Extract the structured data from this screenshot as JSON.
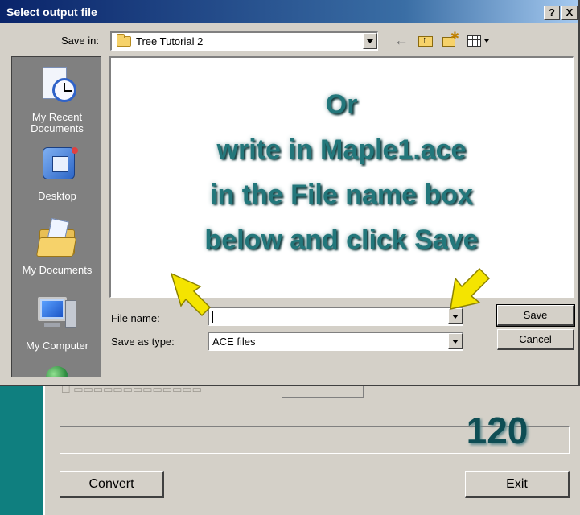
{
  "dialog": {
    "title": "Select output file",
    "help_label": "?",
    "close_label": "X",
    "save_in_label": "Save in:",
    "save_in_value": "Tree Tutorial 2",
    "places": [
      {
        "label_lines": [
          "My Recent",
          "Documents"
        ],
        "icon": "recent-documents-icon"
      },
      {
        "label_lines": [
          "Desktop"
        ],
        "icon": "desktop-icon"
      },
      {
        "label_lines": [
          "My Documents"
        ],
        "icon": "my-documents-icon"
      },
      {
        "label_lines": [
          "My Computer"
        ],
        "icon": "my-computer-icon"
      },
      {
        "label_lines": [],
        "icon": "my-network-icon"
      }
    ],
    "instructions": [
      "Or",
      "write in Maple1.ace",
      "in the File name box",
      "below and click Save"
    ],
    "file_name_label": "File name:",
    "file_name_value": "",
    "save_as_type_label": "Save as type:",
    "save_as_type_value": "ACE files",
    "save_button": "Save",
    "cancel_button": "Cancel"
  },
  "background_app": {
    "progress_value": "120",
    "convert_button": "Convert",
    "exit_button": "Exit"
  },
  "colors": {
    "title_bar": "#0a246a",
    "dialog_face": "#d4d0c8",
    "desktop": "#0f7f7f",
    "instruction_text": "#23777b",
    "annotation_arrow": "#f4e400"
  }
}
